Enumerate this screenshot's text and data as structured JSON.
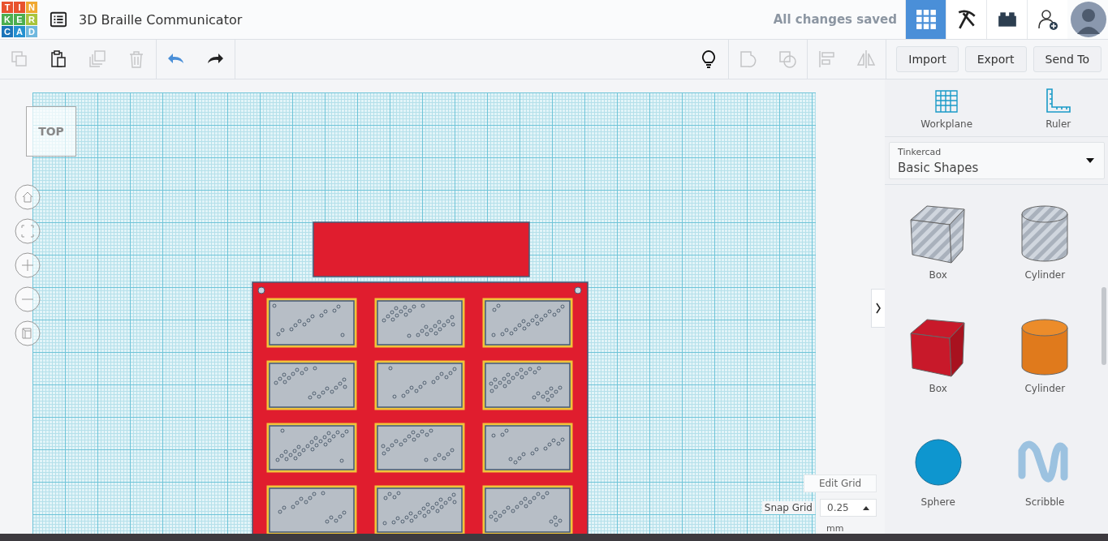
{
  "logo": {
    "letters": [
      {
        "char": "T",
        "color": "#e8532e"
      },
      {
        "char": "I",
        "color": "#e8532e"
      },
      {
        "char": "N",
        "color": "#f0a830"
      },
      {
        "char": "K",
        "color": "#4cae4f"
      },
      {
        "char": "E",
        "color": "#4cae4f"
      },
      {
        "char": "R",
        "color": "#a8c43c"
      },
      {
        "char": "C",
        "color": "#1b74b9"
      },
      {
        "char": "A",
        "color": "#2591d0"
      },
      {
        "char": "D",
        "color": "#6fb8de"
      }
    ]
  },
  "header": {
    "title": "3D Braille Communicator",
    "save_status": "All changes saved",
    "views": [
      {
        "kind": "grid",
        "selected": true
      },
      {
        "kind": "pickaxe",
        "selected": false
      },
      {
        "kind": "brick",
        "selected": false
      }
    ]
  },
  "edit_tools": [
    {
      "kind": "copy",
      "disabled": true
    },
    {
      "kind": "paste",
      "disabled": false
    },
    {
      "kind": "duplicate",
      "disabled": true
    },
    {
      "kind": "delete",
      "disabled": true
    },
    {
      "kind": "undo",
      "disabled": false
    },
    {
      "kind": "redo",
      "disabled": false
    }
  ],
  "shape_tools": [
    {
      "kind": "bulb",
      "disabled": false
    },
    {
      "kind": "group",
      "disabled": true
    },
    {
      "kind": "ungroup",
      "disabled": true
    },
    {
      "kind": "align",
      "disabled": true
    },
    {
      "kind": "mirror",
      "disabled": true
    }
  ],
  "actions": [
    "Import",
    "Export",
    "Send To"
  ],
  "view_cube": {
    "label": "TOP"
  },
  "grid": {
    "edit_label": "Edit Grid",
    "snap_label": "Snap Grid",
    "snap_value": "0.25",
    "snap_unit": "mm"
  },
  "panel": {
    "tools": [
      {
        "kind": "workplane",
        "label": "Workplane"
      },
      {
        "kind": "ruler",
        "label": "Ruler"
      }
    ],
    "library": {
      "source": "Tinkercad",
      "category": "Basic Shapes"
    },
    "shapes": [
      {
        "kind": "hole-box",
        "label": "Box"
      },
      {
        "kind": "hole-cylinder",
        "label": "Cylinder"
      },
      {
        "kind": "box",
        "label": "Box"
      },
      {
        "kind": "cylinder",
        "label": "Cylinder"
      },
      {
        "kind": "sphere",
        "label": "Sphere"
      },
      {
        "kind": "scribble",
        "label": "Scribble"
      }
    ]
  }
}
